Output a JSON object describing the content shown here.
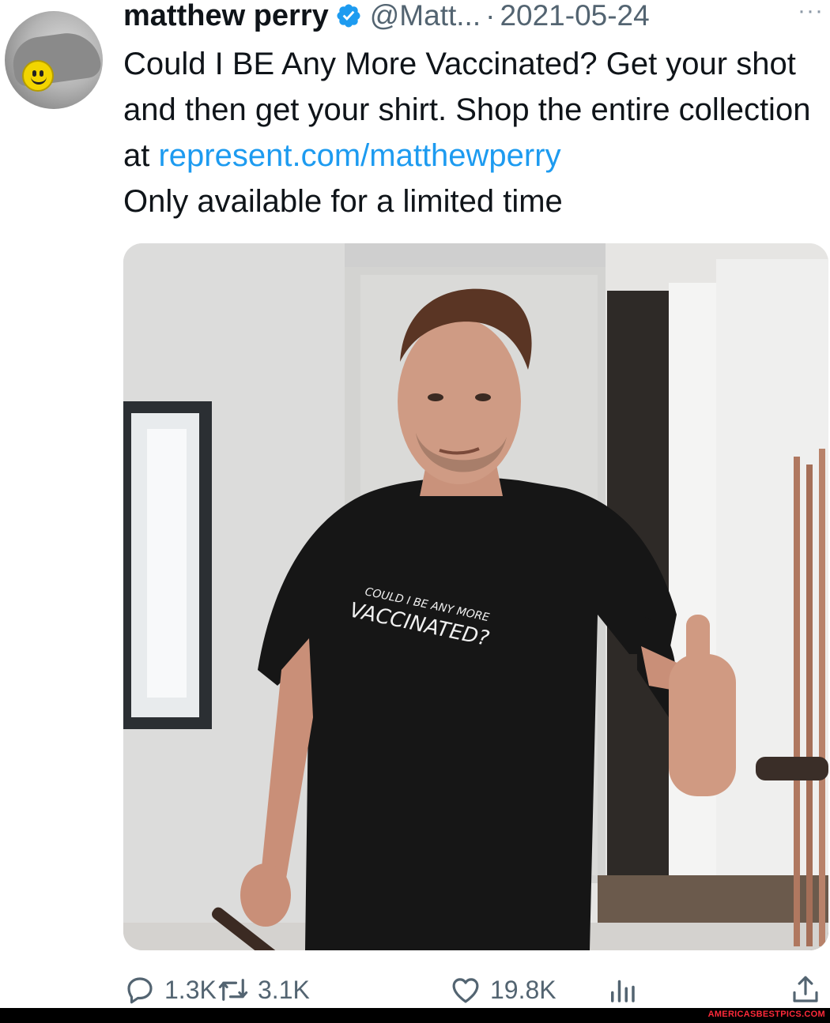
{
  "tweet": {
    "author_name": "matthew perry",
    "handle": "@Matt...",
    "separator": "·",
    "date": "2021-05-24",
    "more_label": "···",
    "text_before_link": "Could I BE Any More Vaccinated? Get your shot and then get your shirt. Shop the entire collection at ",
    "link_text": "represent.com/matthewperry",
    "text_after_link": "Only available for a limited time",
    "shirt_text_line1": "COULD I BE ANY MORE",
    "shirt_text_line2": "VACCINATED?"
  },
  "actions": {
    "replies": "1.3K",
    "retweets": "3.1K",
    "likes": "19.8K"
  },
  "icons": {
    "verified": "verified-badge-icon",
    "more": "more-icon",
    "reply": "reply-icon",
    "retweet": "retweet-icon",
    "like": "heart-icon",
    "views": "views-icon",
    "share": "share-icon"
  },
  "colors": {
    "link": "#1d9bf0",
    "verified": "#1d9bf0",
    "secondary_text": "#536471",
    "primary_text": "#0f1419"
  },
  "footer": {
    "watermark": "AMERICASBESTPICS.COM"
  }
}
